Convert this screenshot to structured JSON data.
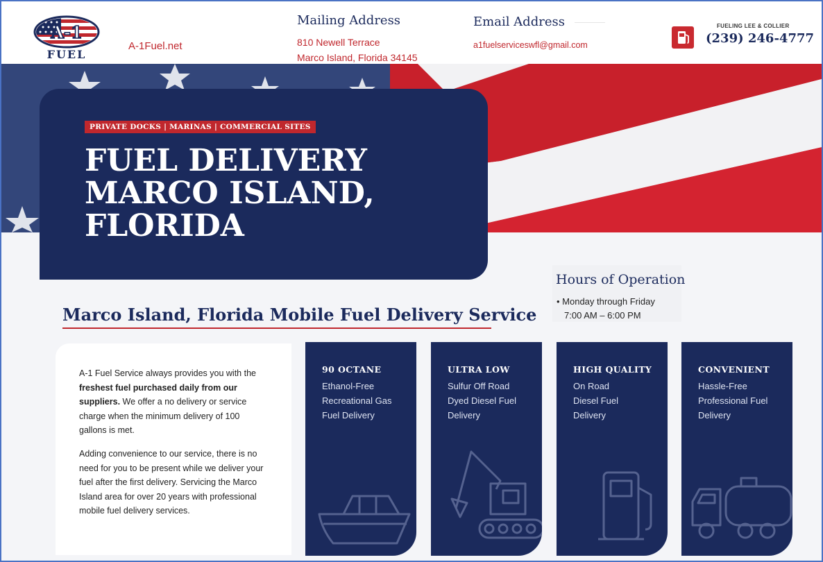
{
  "header": {
    "logo_text_top": "A-1",
    "logo_text_bottom": "FUEL",
    "site_link": "A-1Fuel.net",
    "mailing_title": "Mailing Address",
    "mailing_line1": "810 Newell Terrace",
    "mailing_line2": "Marco Island, Florida 34145",
    "email_title": "Email Address",
    "email_value": "a1fuelserviceswfl@gmail.com",
    "tagline": "FUELING LEE & COLLIER",
    "phone": "(239) 246-4777"
  },
  "hero": {
    "badge": "PRIVATE DOCKS | MARINAS | COMMERCIAL SITES",
    "title_line1": "FUEL DELIVERY",
    "title_line2": "MARCO ISLAND,",
    "title_line3": "FLORIDA"
  },
  "hours": {
    "title": "Hours of Operation",
    "line1": "• Monday through Friday",
    "line2": "7:00 AM – 6:00 PM"
  },
  "section": {
    "title": "Marco Island, Florida Mobile Fuel Delivery Service",
    "para1_a": "A-1 Fuel Service always provides you with the ",
    "para1_bold": "freshest fuel purchased daily from our suppliers.",
    "para1_b": " We offer a no delivery or service charge when the minimum delivery of 100 gallons is met.",
    "para2": "Adding convenience to our service, there is no need for you to be present while we deliver your fuel after the first delivery. Servicing the Marco Island area for over 20 years with professional mobile fuel delivery services."
  },
  "cards": [
    {
      "title": "90 OCTANE",
      "line1": "Ethanol-Free",
      "line2": "Recreational Gas",
      "line3": "Fuel Delivery",
      "icon": "boat-icon"
    },
    {
      "title": "ULTRA LOW",
      "line1": "Sulfur Off Road",
      "line2": "Dyed Diesel Fuel",
      "line3": "Delivery",
      "icon": "excavator-icon"
    },
    {
      "title": "HIGH QUALITY",
      "line1": "On Road",
      "line2": "Diesel Fuel",
      "line3": "Delivery",
      "icon": "fuel-pump-icon"
    },
    {
      "title": "CONVENIENT",
      "line1": "Hassle-Free",
      "line2": "Professional Fuel",
      "line3": "Delivery",
      "icon": "tanker-truck-icon"
    }
  ],
  "colors": {
    "navy": "#1b2a5c",
    "accent_red": "#c0272d",
    "frame_blue": "#4a72c4"
  }
}
